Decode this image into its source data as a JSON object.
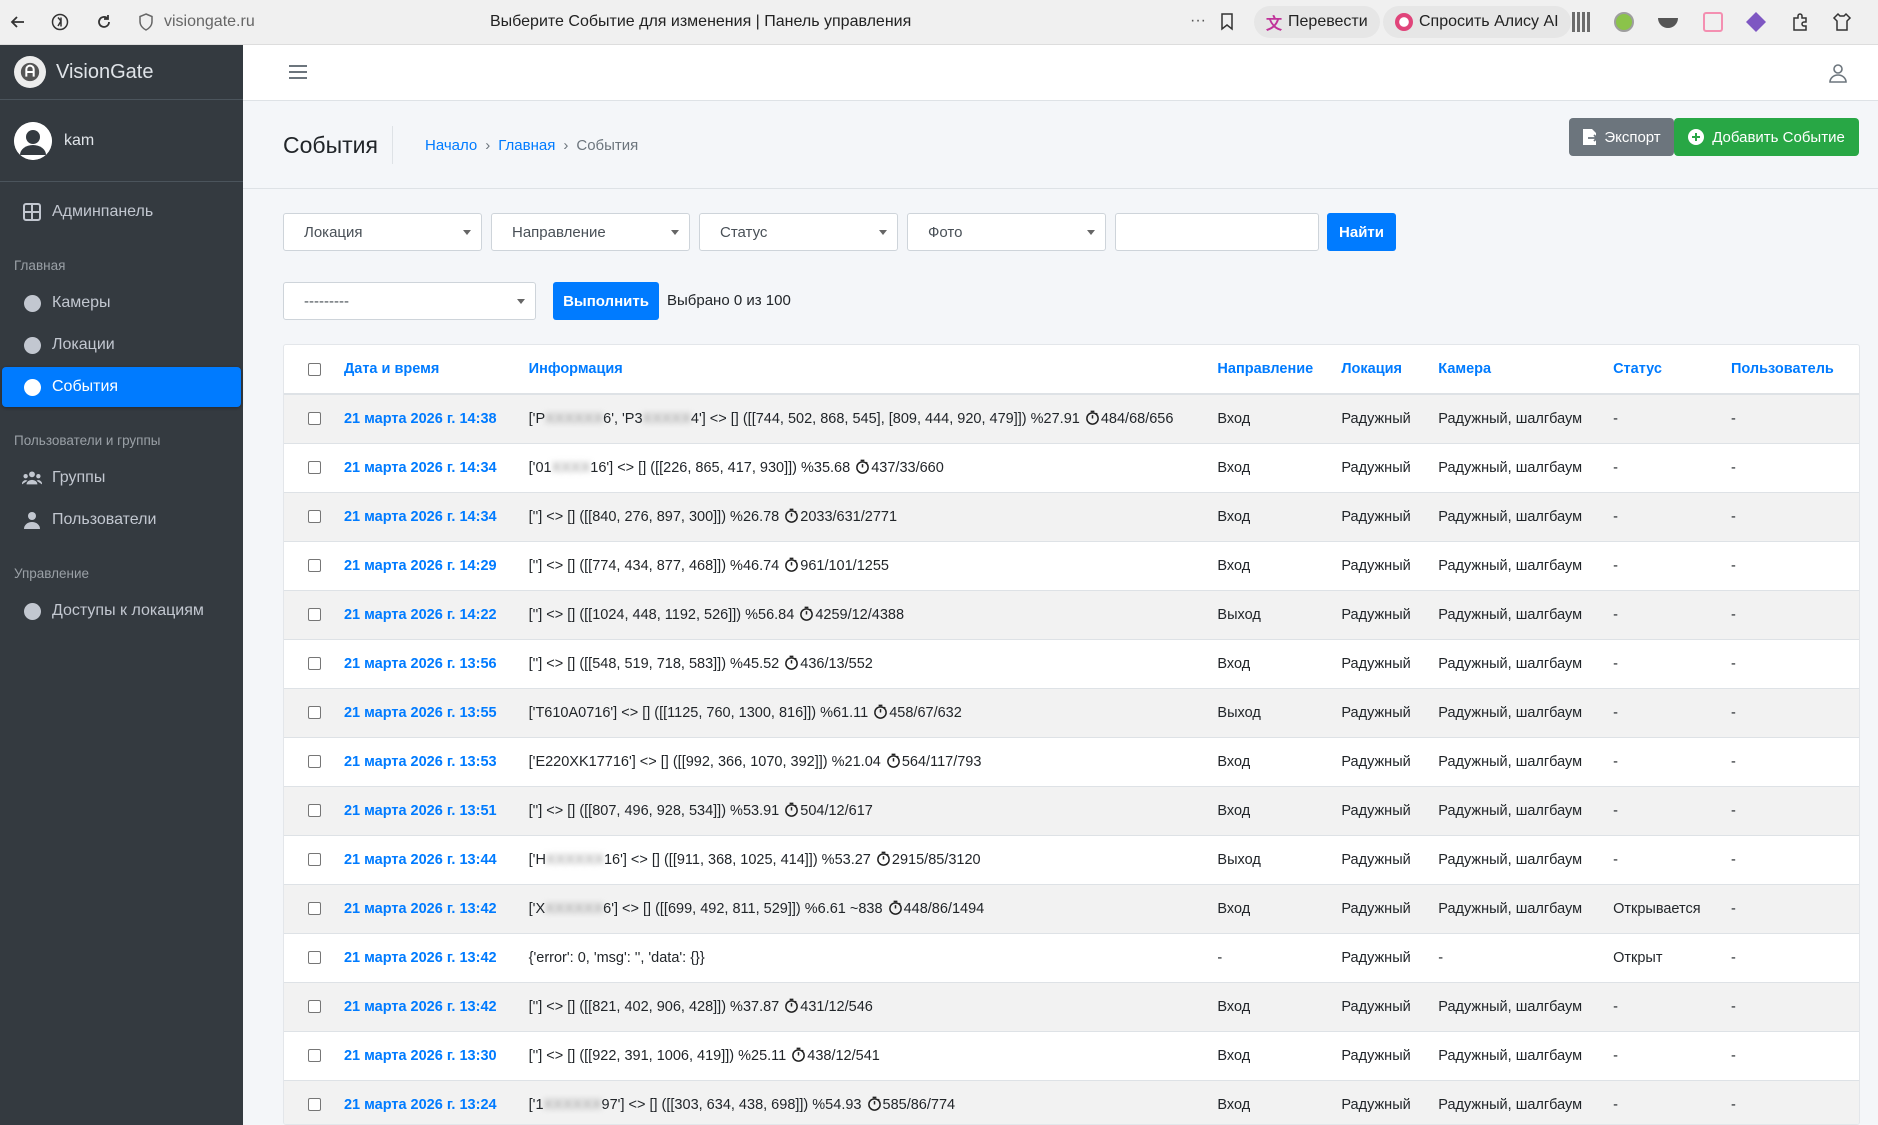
{
  "browser": {
    "url": "visiongate.ru",
    "tab_title": "Выберите Событие для изменения | Панель управления",
    "translate_label": "Перевести",
    "alice_label": "Спросить Алису AI"
  },
  "sidebar": {
    "brand": "VisionGate",
    "user": "kam",
    "items": [
      {
        "type": "item",
        "label": "Админпанель",
        "icon": "dashboard-icon"
      },
      {
        "type": "header",
        "label": "Главная"
      },
      {
        "type": "item",
        "label": "Камеры",
        "icon": "circle-icon"
      },
      {
        "type": "item",
        "label": "Локации",
        "icon": "circle-icon"
      },
      {
        "type": "item",
        "label": "События",
        "icon": "circle-icon",
        "active": true
      },
      {
        "type": "header",
        "label": "Пользователи и группы"
      },
      {
        "type": "item",
        "label": "Группы",
        "icon": "users-icon"
      },
      {
        "type": "item",
        "label": "Пользователи",
        "icon": "user-icon"
      },
      {
        "type": "header",
        "label": "Управление"
      },
      {
        "type": "item",
        "label": "Доступы к локациям",
        "icon": "circle-icon"
      }
    ]
  },
  "header": {
    "title": "События",
    "breadcrumb": [
      "Начало",
      "Главная",
      "События"
    ],
    "export_label": "Экспорт",
    "add_label": "Добавить Событие"
  },
  "filters": {
    "location": "Локация",
    "direction": "Направление",
    "status": "Статус",
    "photo": "Фото",
    "search_value": "",
    "find_label": "Найти"
  },
  "actions": {
    "action_select": "---------",
    "run_label": "Выполнить",
    "selected_text": "Выбрано 0 из 100"
  },
  "table": {
    "columns": [
      "Дата и время",
      "Информация",
      "Направление",
      "Локация",
      "Камера",
      "Статус",
      "Пользователь"
    ],
    "rows": [
      {
        "dt": "21 марта 2026 г. 14:38",
        "pre": "['Р",
        "hidden": "XXXXXX",
        "mid": "6', 'Р3",
        "hidden2": "XXXXX",
        "post": "4'] <> [] ([[744, 502, 868, 545], [809, 444, 920, 479]]) %27.91 ",
        "timer": "484/68/656",
        "dir": "Вход",
        "loc": "Радужный",
        "cam": "Радужный, шалгбаум",
        "status": "-",
        "user": "-"
      },
      {
        "dt": "21 марта 2026 г. 14:34",
        "pre": "['01",
        "hidden": "XXXX",
        "post": "16'] <> [] ([[226, 865, 417, 930]]) %35.68 ",
        "timer": "437/33/660",
        "dir": "Вход",
        "loc": "Радужный",
        "cam": "Радужный, шалгбаум",
        "status": "-",
        "user": "-"
      },
      {
        "dt": "21 марта 2026 г. 14:34",
        "pre": "['']",
        "post": " <> [] ([[840, 276, 897, 300]]) %26.78 ",
        "timer": "2033/631/2771",
        "dir": "Вход",
        "loc": "Радужный",
        "cam": "Радужный, шалгбаум",
        "status": "-",
        "user": "-"
      },
      {
        "dt": "21 марта 2026 г. 14:29",
        "pre": "['']",
        "post": " <> [] ([[774, 434, 877, 468]]) %46.74 ",
        "timer": "961/101/1255",
        "dir": "Вход",
        "loc": "Радужный",
        "cam": "Радужный, шалгбаум",
        "status": "-",
        "user": "-"
      },
      {
        "dt": "21 марта 2026 г. 14:22",
        "pre": "['']",
        "post": " <> [] ([[1024, 448, 1192, 526]]) %56.84 ",
        "timer": "4259/12/4388",
        "dir": "Выход",
        "loc": "Радужный",
        "cam": "Радужный, шалгбаум",
        "status": "-",
        "user": "-"
      },
      {
        "dt": "21 марта 2026 г. 13:56",
        "pre": "['']",
        "post": " <> [] ([[548, 519, 718, 583]]) %45.52 ",
        "timer": "436/13/552",
        "dir": "Вход",
        "loc": "Радужный",
        "cam": "Радужный, шалгбаум",
        "status": "-",
        "user": "-"
      },
      {
        "dt": "21 марта 2026 г. 13:55",
        "pre": "['T610A0716']",
        "post": " <> [] ([[1125, 760, 1300, 816]]) %61.11 ",
        "timer": "458/67/632",
        "dir": "Выход",
        "loc": "Радужный",
        "cam": "Радужный, шалгбаум",
        "status": "-",
        "user": "-"
      },
      {
        "dt": "21 марта 2026 г. 13:53",
        "pre": "['E220XK17716']",
        "post": " <> [] ([[992, 366, 1070, 392]]) %21.04 ",
        "timer": "564/117/793",
        "dir": "Вход",
        "loc": "Радужный",
        "cam": "Радужный, шалгбаум",
        "status": "-",
        "user": "-"
      },
      {
        "dt": "21 марта 2026 г. 13:51",
        "pre": "['']",
        "post": " <> [] ([[807, 496, 928, 534]]) %53.91 ",
        "timer": "504/12/617",
        "dir": "Вход",
        "loc": "Радужный",
        "cam": "Радужный, шалгбаум",
        "status": "-",
        "user": "-"
      },
      {
        "dt": "21 марта 2026 г. 13:44",
        "pre": "['Н",
        "hidden": "XXXXXX",
        "post": "16'] <> [] ([[911, 368, 1025, 414]]) %53.27 ",
        "timer": "2915/85/3120",
        "dir": "Выход",
        "loc": "Радужный",
        "cam": "Радужный, шалгбаум",
        "status": "-",
        "user": "-"
      },
      {
        "dt": "21 марта 2026 г. 13:42",
        "pre": "['X",
        "hidden": "XXXXXX",
        "post": "6'] <> [] ([[699, 492, 811, 529]]) %6.61 ~838 ",
        "timer": "448/86/1494",
        "dir": "Вход",
        "loc": "Радужный",
        "cam": "Радужный, шалгбаум",
        "status": "Открывается",
        "user": "-"
      },
      {
        "dt": "21 марта 2026 г. 13:42",
        "pre": "{'error': 0, 'msg': '', 'data': {}}",
        "post": "",
        "dir": "-",
        "loc": "Радужный",
        "cam": "-",
        "status": "Открыт",
        "user": "-"
      },
      {
        "dt": "21 марта 2026 г. 13:42",
        "pre": "['']",
        "post": " <> [] ([[821, 402, 906, 428]]) %37.87 ",
        "timer": "431/12/546",
        "dir": "Вход",
        "loc": "Радужный",
        "cam": "Радужный, шалгбаум",
        "status": "-",
        "user": "-"
      },
      {
        "dt": "21 марта 2026 г. 13:30",
        "pre": "['']",
        "post": " <> [] ([[922, 391, 1006, 419]]) %25.11 ",
        "timer": "438/12/541",
        "dir": "Вход",
        "loc": "Радужный",
        "cam": "Радужный, шалгбаум",
        "status": "-",
        "user": "-"
      },
      {
        "dt": "21 марта 2026 г. 13:24",
        "pre": "['1",
        "hidden": "XXXXXX",
        "post": "97'] <> [] ([[303, 634, 438, 698]]) %54.93 ",
        "timer": "585/86/774",
        "dir": "Вход",
        "loc": "Радужный",
        "cam": "Радужный, шалгбаум",
        "status": "-",
        "user": "-"
      }
    ]
  }
}
